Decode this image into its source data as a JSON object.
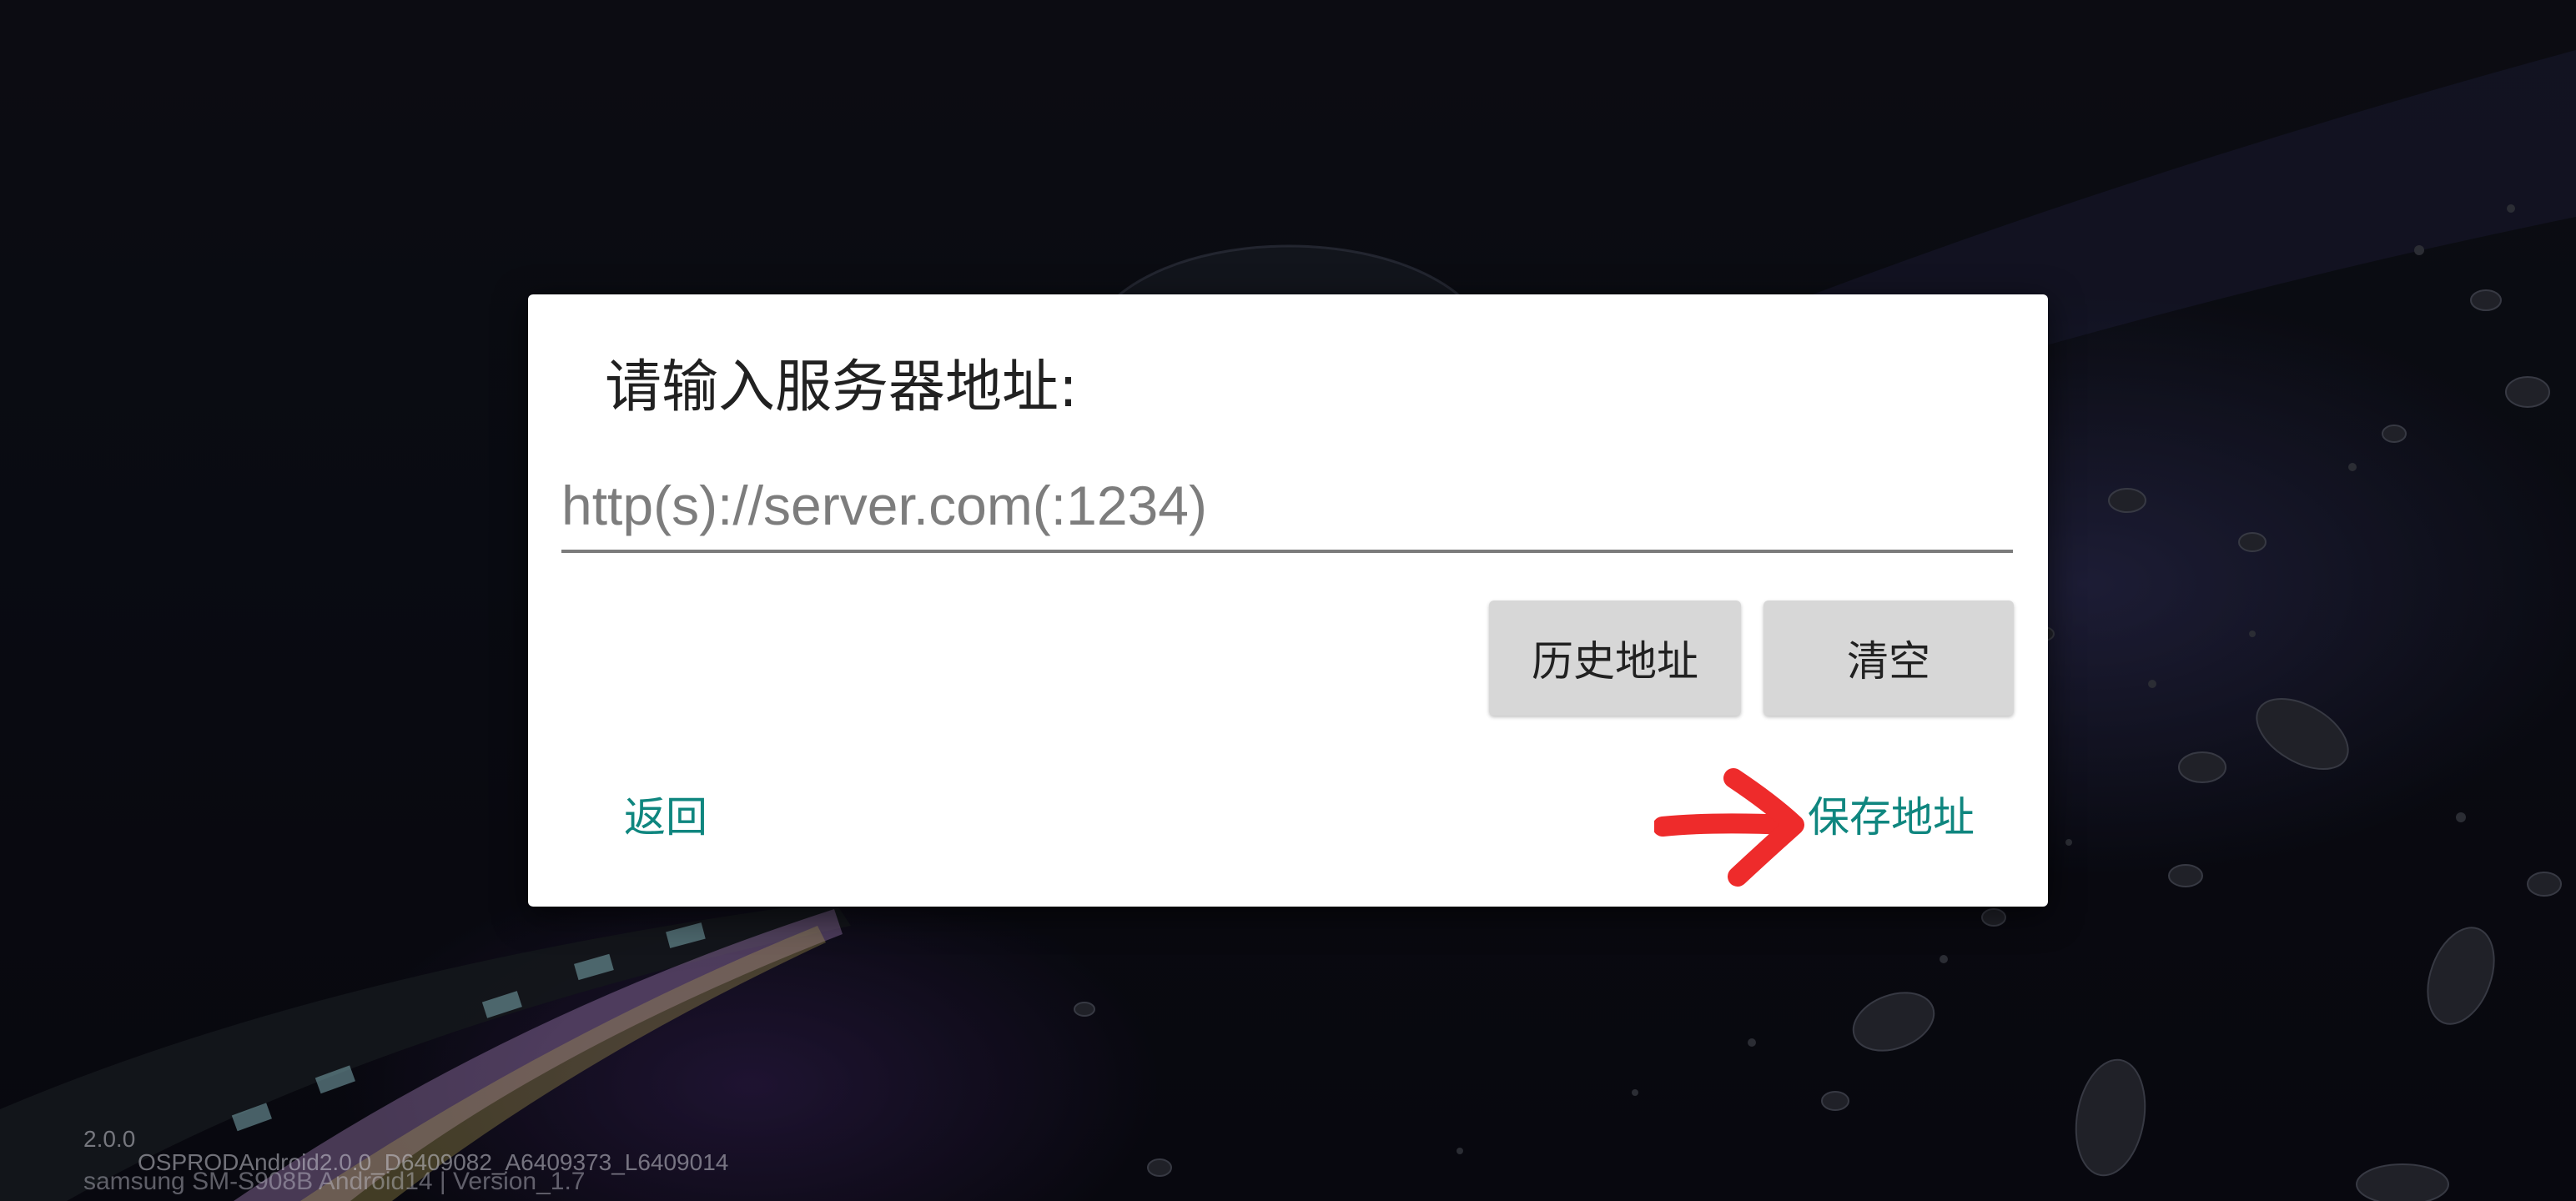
{
  "dialog": {
    "title": "请输入服务器地址:",
    "input": {
      "value": "",
      "placeholder": "http(s)://server.com(:1234)"
    },
    "history_button": "历史地址",
    "clear_button": "清空",
    "back_button": "返回",
    "save_button": "保存地址"
  },
  "footer": {
    "version": "2.0.0",
    "build": "OSPRODAndroid2.0.0_D6409082_A6409373_L6409014",
    "device": "samsung SM-S908B Android14 | Version_1.7"
  },
  "colors": {
    "accent": "#0f867f",
    "annotation_arrow": "#ee2b2b",
    "button_gray": "#d7d7d7"
  },
  "icons": {
    "annotation": "red-arrow-icon"
  }
}
